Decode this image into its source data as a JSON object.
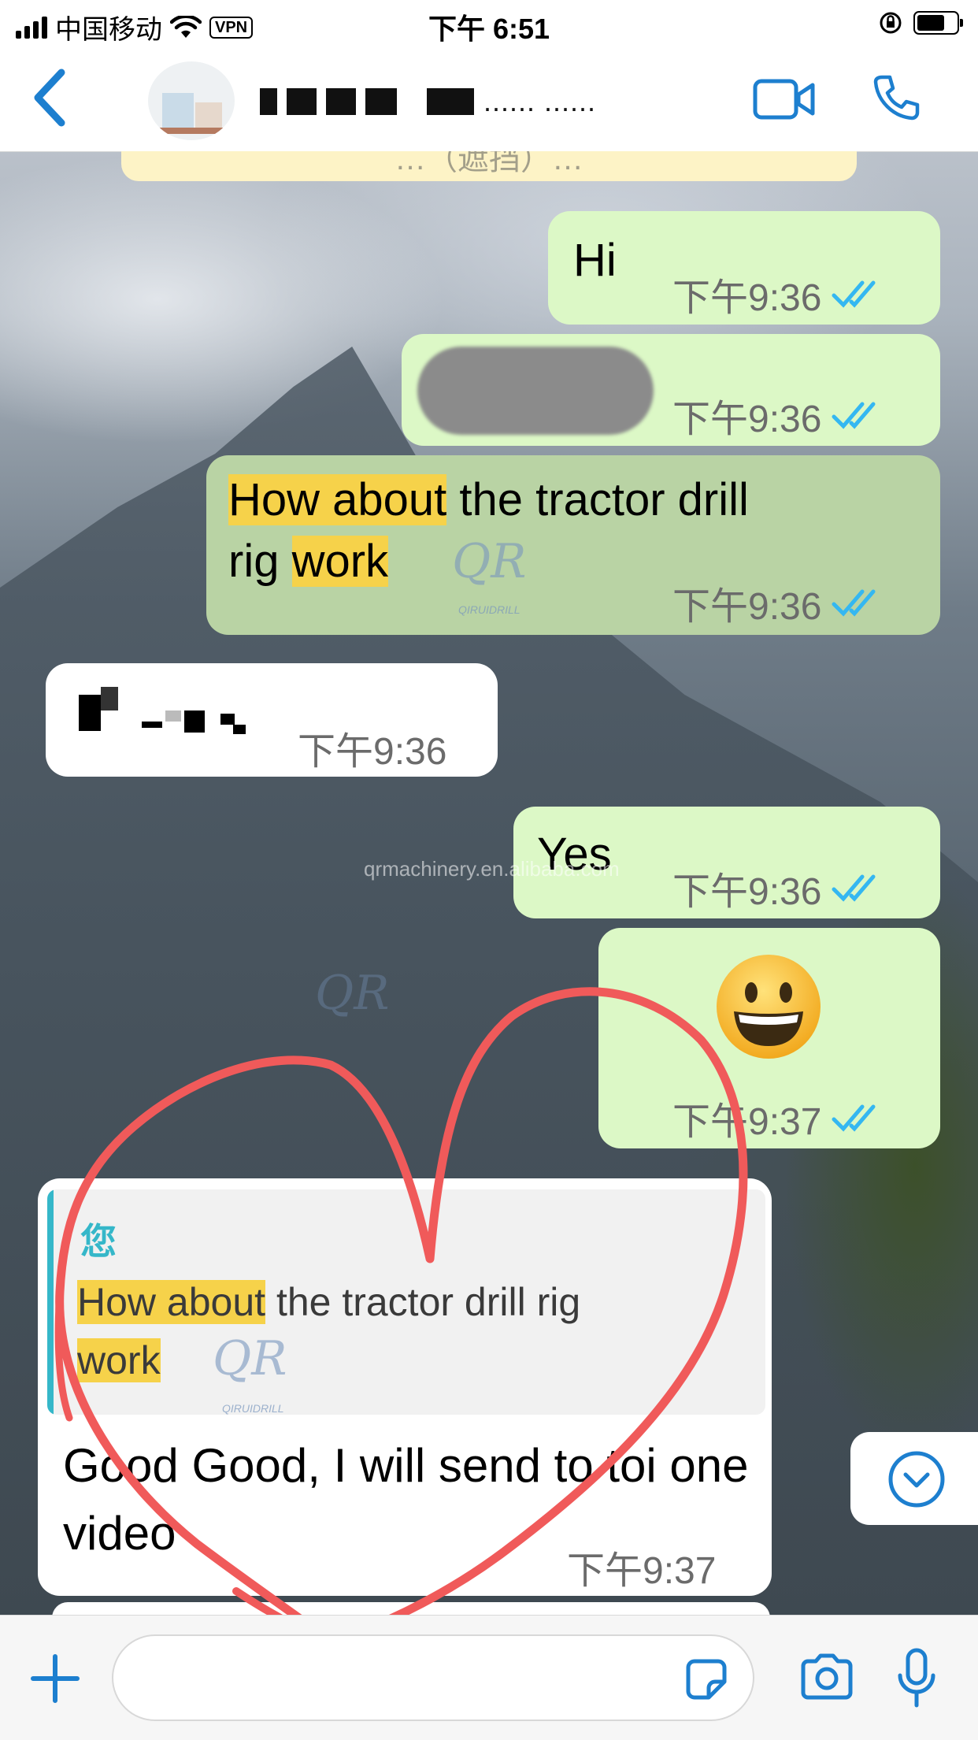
{
  "status_bar": {
    "carrier": "中国移动",
    "vpn": "VPN",
    "time": "下午 6:51"
  },
  "header": {
    "contact_name": "...... ......"
  },
  "system_notice": "…（遮挡）…",
  "messages": [
    {
      "dir": "out",
      "text": "Hi",
      "time": "下午9:36",
      "status": "read"
    },
    {
      "dir": "out",
      "text": "",
      "time": "下午9:36",
      "status": "read"
    },
    {
      "dir": "out",
      "text_parts": [
        "How about",
        " the tractor drill ",
        "rig",
        " ",
        "work"
      ],
      "time": "下午9:36",
      "status": "read"
    },
    {
      "dir": "in",
      "text": "",
      "time": "下午9:36"
    },
    {
      "dir": "out",
      "text": "Yes",
      "time": "下午9:36",
      "status": "read"
    },
    {
      "dir": "out",
      "text": "😀",
      "time": "下午9:37",
      "status": "read"
    },
    {
      "dir": "in",
      "quote": {
        "author": "您",
        "text_parts": [
          "How about",
          " the tractor drill rig ",
          "work"
        ]
      },
      "text": "Good Good, I will send to toi one video",
      "time": "下午9:37"
    }
  ],
  "watermarks": {
    "url": "qrmachinery.en.alibaba.com",
    "logo": "QR",
    "brand": "QIRUIDRILL"
  },
  "input": {
    "placeholder": ""
  },
  "colors": {
    "accent": "#1d7fcf",
    "outgoing_bubble": "#dcf8c6",
    "incoming_bubble": "#ffffff",
    "highlight": "#f6d24a",
    "read_ticks": "#34b7f1",
    "annotation": "#f05a5a"
  },
  "icons": [
    "back-chevron-icon",
    "video-call-icon",
    "phone-call-icon",
    "plus-icon",
    "sticker-icon",
    "camera-icon",
    "microphone-icon",
    "chevron-down-icon",
    "double-check-icon"
  ]
}
